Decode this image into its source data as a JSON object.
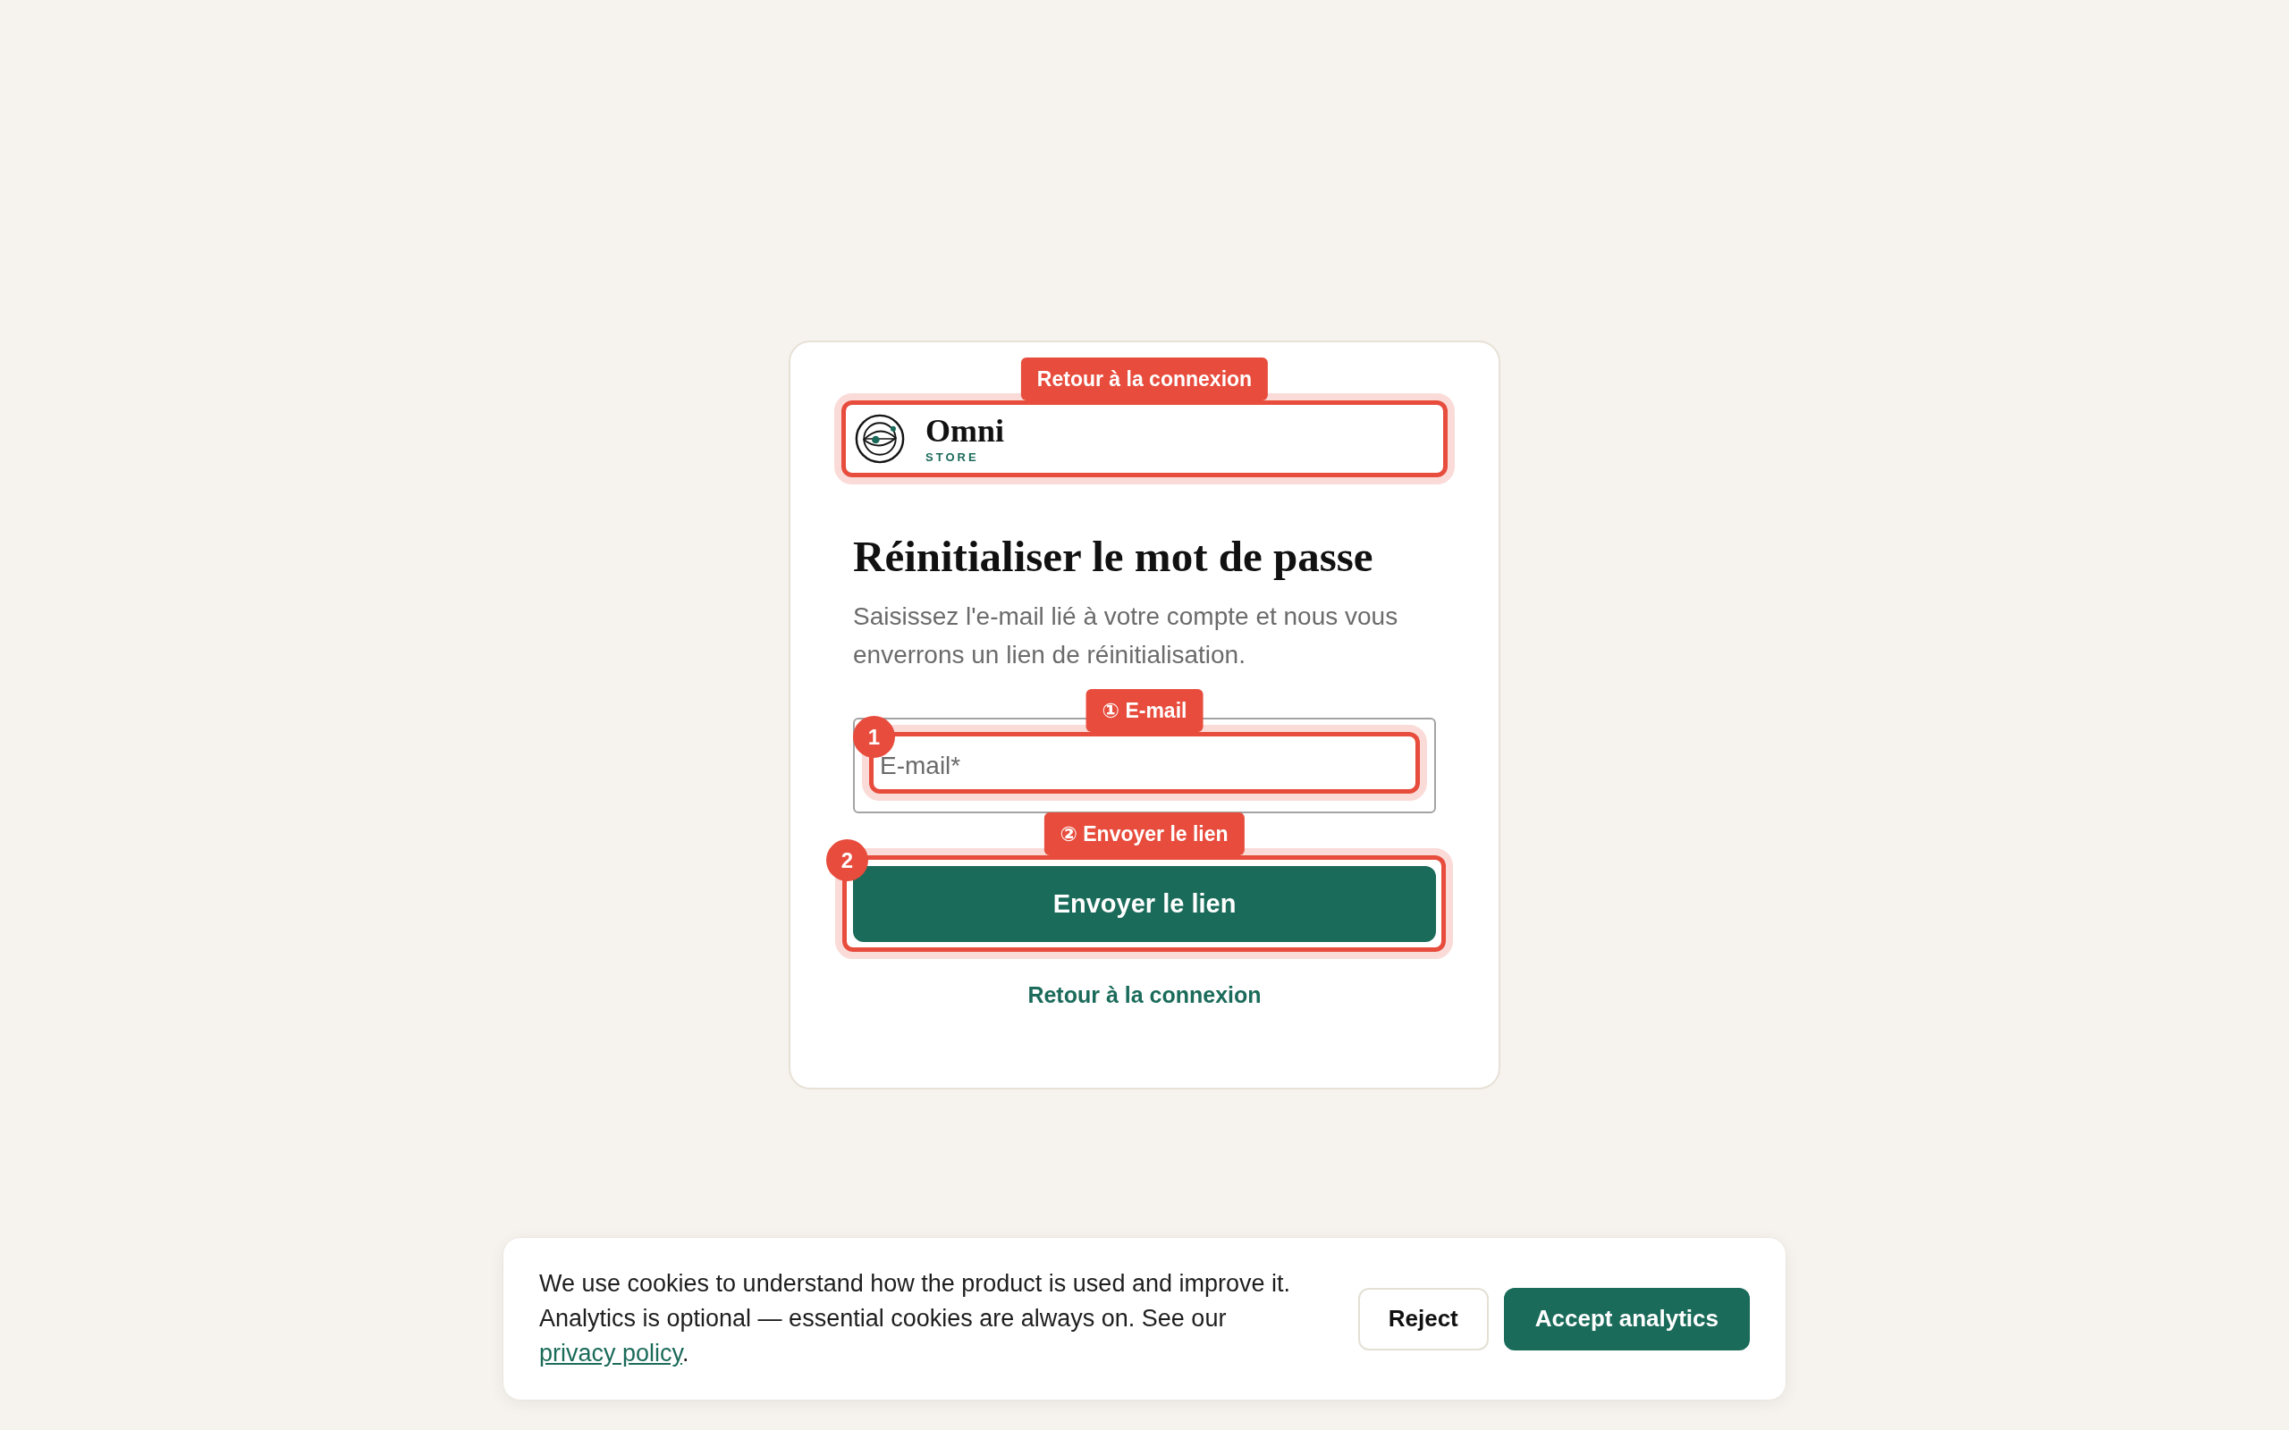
{
  "logo": {
    "name": "Omni",
    "tagline": "STORE",
    "annotation": {
      "label": "Retour à la connexion"
    }
  },
  "heading": "Réinitialiser le mot de passe",
  "description": "Saisissez l'e-mail lié à votre compte et nous vous enverrons un lien de réinitialisation.",
  "form": {
    "email": {
      "placeholder": "E-mail*",
      "annotation": {
        "label": "① E-mail",
        "number": "1"
      }
    },
    "submit": {
      "label": "Envoyer le lien",
      "annotation": {
        "label": "② Envoyer le lien",
        "number": "2"
      }
    }
  },
  "back_link": "Retour à la connexion",
  "cookie_banner": {
    "text": "We use cookies to understand how the product is used and improve it. Analytics is optional — essential cookies are always on. See our ",
    "link": "privacy policy",
    "after_link": ".",
    "buttons": [
      {
        "label": "Reject",
        "kind": "secondary"
      },
      {
        "label": "Accept analytics",
        "kind": "primary"
      }
    ]
  }
}
